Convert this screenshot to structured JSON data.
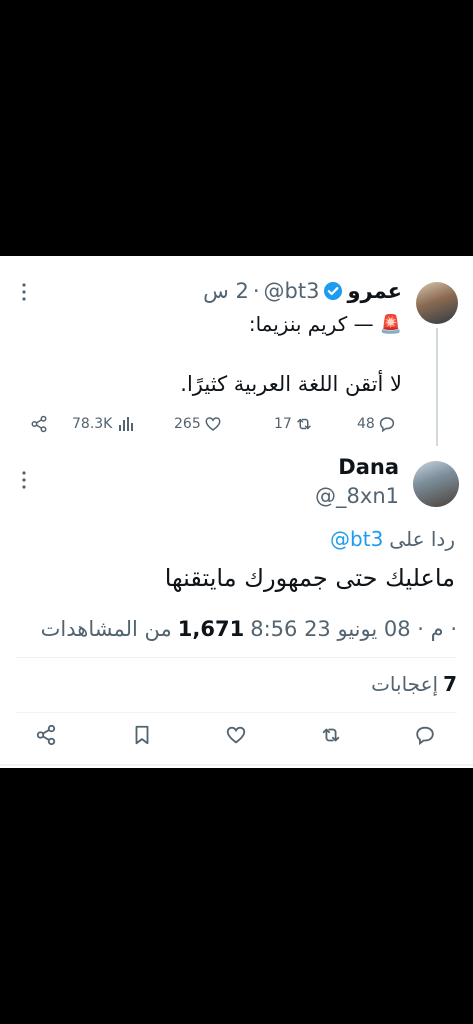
{
  "quoted": {
    "name": "عمرو",
    "handle": "@bt3",
    "separator": "·",
    "time": "2 س",
    "line1": "— كريم بنزيما:",
    "siren": "🚨",
    "line2": "لا أتقن اللغة العربية كثيرًا.",
    "stats": {
      "views": "78.3K",
      "likes": "265",
      "retweets": "17",
      "replies": "48"
    }
  },
  "reply": {
    "name": "Dana",
    "handle": "@_8xn1",
    "replying_to_prefix": "ردا على",
    "replying_to_handle": "@bt3",
    "text": "ماعليك حتى جمهورك مايتقنها",
    "meta_time": "8:56 م · 08 يونيو 23 ·",
    "meta_views_count": "1,671",
    "meta_views_label": "من المشاهدات",
    "likes_count": "7",
    "likes_label": "إعجابات"
  },
  "colors": {
    "accent": "#1d9bf0",
    "verified": "#1d9bf0",
    "muted": "#536471"
  }
}
